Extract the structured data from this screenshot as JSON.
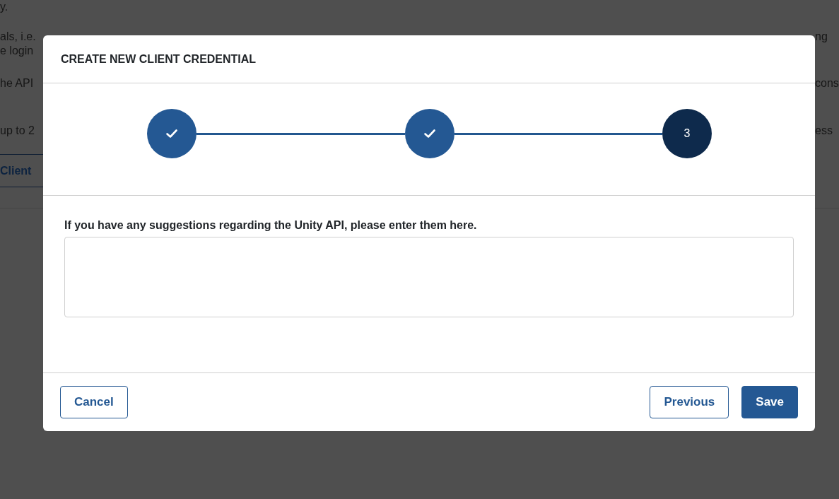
{
  "background": {
    "paragraphs": [
      {
        "lines": [
          {
            "left": "y."
          }
        ]
      },
      {
        "lines": [
          {
            "left": "als, i.e.",
            "right": "ng"
          },
          {
            "left": "e login"
          }
        ]
      },
      {
        "lines": [
          {
            "left": "he API",
            "right": "cons"
          }
        ]
      },
      {
        "lines": [
          {
            "left": "up to 2",
            "right": "ess"
          }
        ]
      }
    ],
    "button": "Client"
  },
  "dialog": {
    "title": "CREATE NEW CLIENT CREDENTIAL",
    "steps": [
      {
        "completed": true,
        "selected": false
      },
      {
        "completed": true,
        "selected": false
      },
      {
        "completed": false,
        "selected": true,
        "number": "3"
      }
    ],
    "field": {
      "label": "If you have any suggestions regarding the Unity API, please enter them here."
    },
    "footer": {
      "left": [
        {
          "label": "Cancel",
          "kind": "outline"
        }
      ],
      "right": [
        {
          "label": "Previous",
          "kind": "outline"
        },
        {
          "label": "Save",
          "kind": "primary"
        }
      ]
    }
  }
}
